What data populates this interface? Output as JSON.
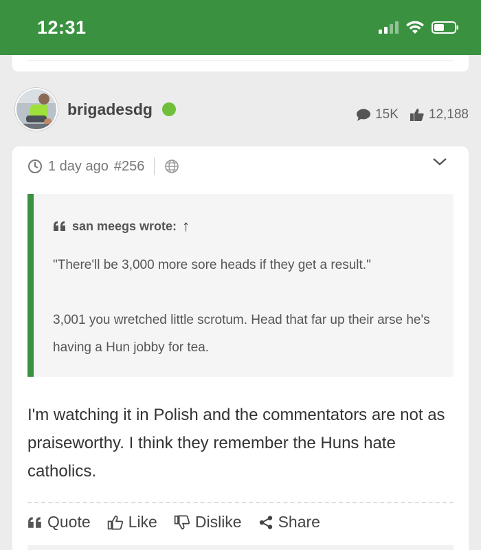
{
  "status_bar": {
    "time": "12:31"
  },
  "author": {
    "username": "brigadesdg",
    "posts": "15K",
    "likes": "12,188"
  },
  "post": {
    "time_ago": "1 day ago",
    "number": "#256",
    "quote": {
      "author_label": "san meegs wrote:",
      "arrow": "↑",
      "lines": [
        "\"There'll be 3,000 more sore heads if they get a result.\"",
        "3,001 you wretched little scrotum. Head that far up their arse he's having a Hun jobby for tea."
      ]
    },
    "body": "I'm watching it in Polish and the commentators are not as praiseworthy. I think they remember the Huns hate catholics.",
    "actions": {
      "quote": "Quote",
      "like": "Like",
      "dislike": "Dislike",
      "share": "Share"
    }
  },
  "colors": {
    "brand_green": "#3a9140",
    "online": "#6fbf3a"
  }
}
